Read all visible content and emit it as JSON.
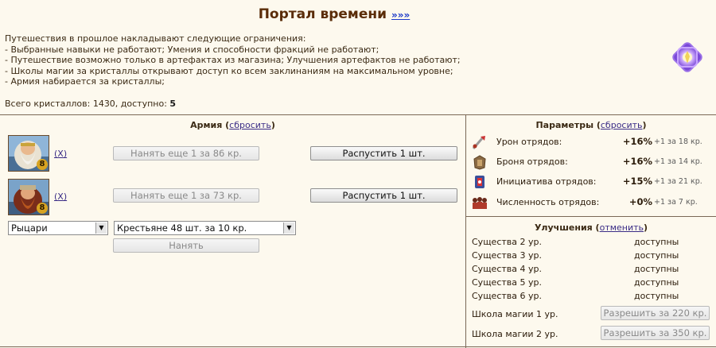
{
  "header": {
    "title": "Портал времени",
    "link": "»»»"
  },
  "intro": {
    "heading": "Путешествия в прошлое накладывают следующие ограничения:",
    "lines": [
      "- Выбранные навыки не работают; Умения и способности фракций не работают;",
      "- Путешествие возможно только в артефактах из магазина; Улучшения артефактов не работают;",
      "- Школы магии за кристаллы открывают доступ ко всем заклинаниям на максимальном уровне;",
      "- Армия набирается за кристаллы;"
    ],
    "crystals_text": "Всего кристаллов: 1430, доступно: ",
    "crystals_available": "5"
  },
  "army": {
    "title": "Армия",
    "reset_link": "сбросить",
    "units": [
      {
        "level": "8",
        "remove": "(X)",
        "hire": "Нанять еще 1 за 86 кр.",
        "dismiss": "Распустить 1 шт."
      },
      {
        "level": "8",
        "remove": "(X)",
        "hire": "Нанять еще 1 за 73 кр.",
        "dismiss": "Распустить 1 шт."
      }
    ],
    "faction_select": "Рыцари",
    "unit_select": "Крестьяне 48 шт. за 10 кр.",
    "hire_button": "Нанять"
  },
  "params": {
    "title": "Параметры",
    "reset_link": "сбросить",
    "rows": [
      {
        "icon": "sword-damage-icon",
        "label": "Урон отрядов:",
        "value": "+16%",
        "note": "+1 за 18 кр."
      },
      {
        "icon": "armor-icon",
        "label": "Броня отрядов:",
        "value": "+16%",
        "note": "+1 за 14 кр."
      },
      {
        "icon": "initiative-icon",
        "label": "Инициатива отрядов:",
        "value": "+15%",
        "note": "+1 за 21 кр."
      },
      {
        "icon": "troop-count-icon",
        "label": "Численность отрядов:",
        "value": "+0%",
        "note": "+1 за 7 кр."
      }
    ]
  },
  "upgrades": {
    "title": "Улучшения",
    "cancel_link": "отменить",
    "rows": [
      {
        "label": "Существа 2 ур.",
        "status": "доступны"
      },
      {
        "label": "Существа 3 ур.",
        "status": "доступны"
      },
      {
        "label": "Существа 4 ур.",
        "status": "доступны"
      },
      {
        "label": "Существа 5 ур.",
        "status": "доступны"
      },
      {
        "label": "Существа 6 ур.",
        "status": "доступны"
      }
    ],
    "magic": [
      {
        "label": "Школа магии 1 ур.",
        "button": "Разрешить за 220 кр."
      },
      {
        "label": "Школа магии 2 ур.",
        "button": "Разрешить за 350 кр."
      }
    ]
  },
  "colors": {
    "background": "#fdf9ee",
    "title": "#5a2c08",
    "link": "#3a2c86",
    "divider": "#7a6856"
  }
}
